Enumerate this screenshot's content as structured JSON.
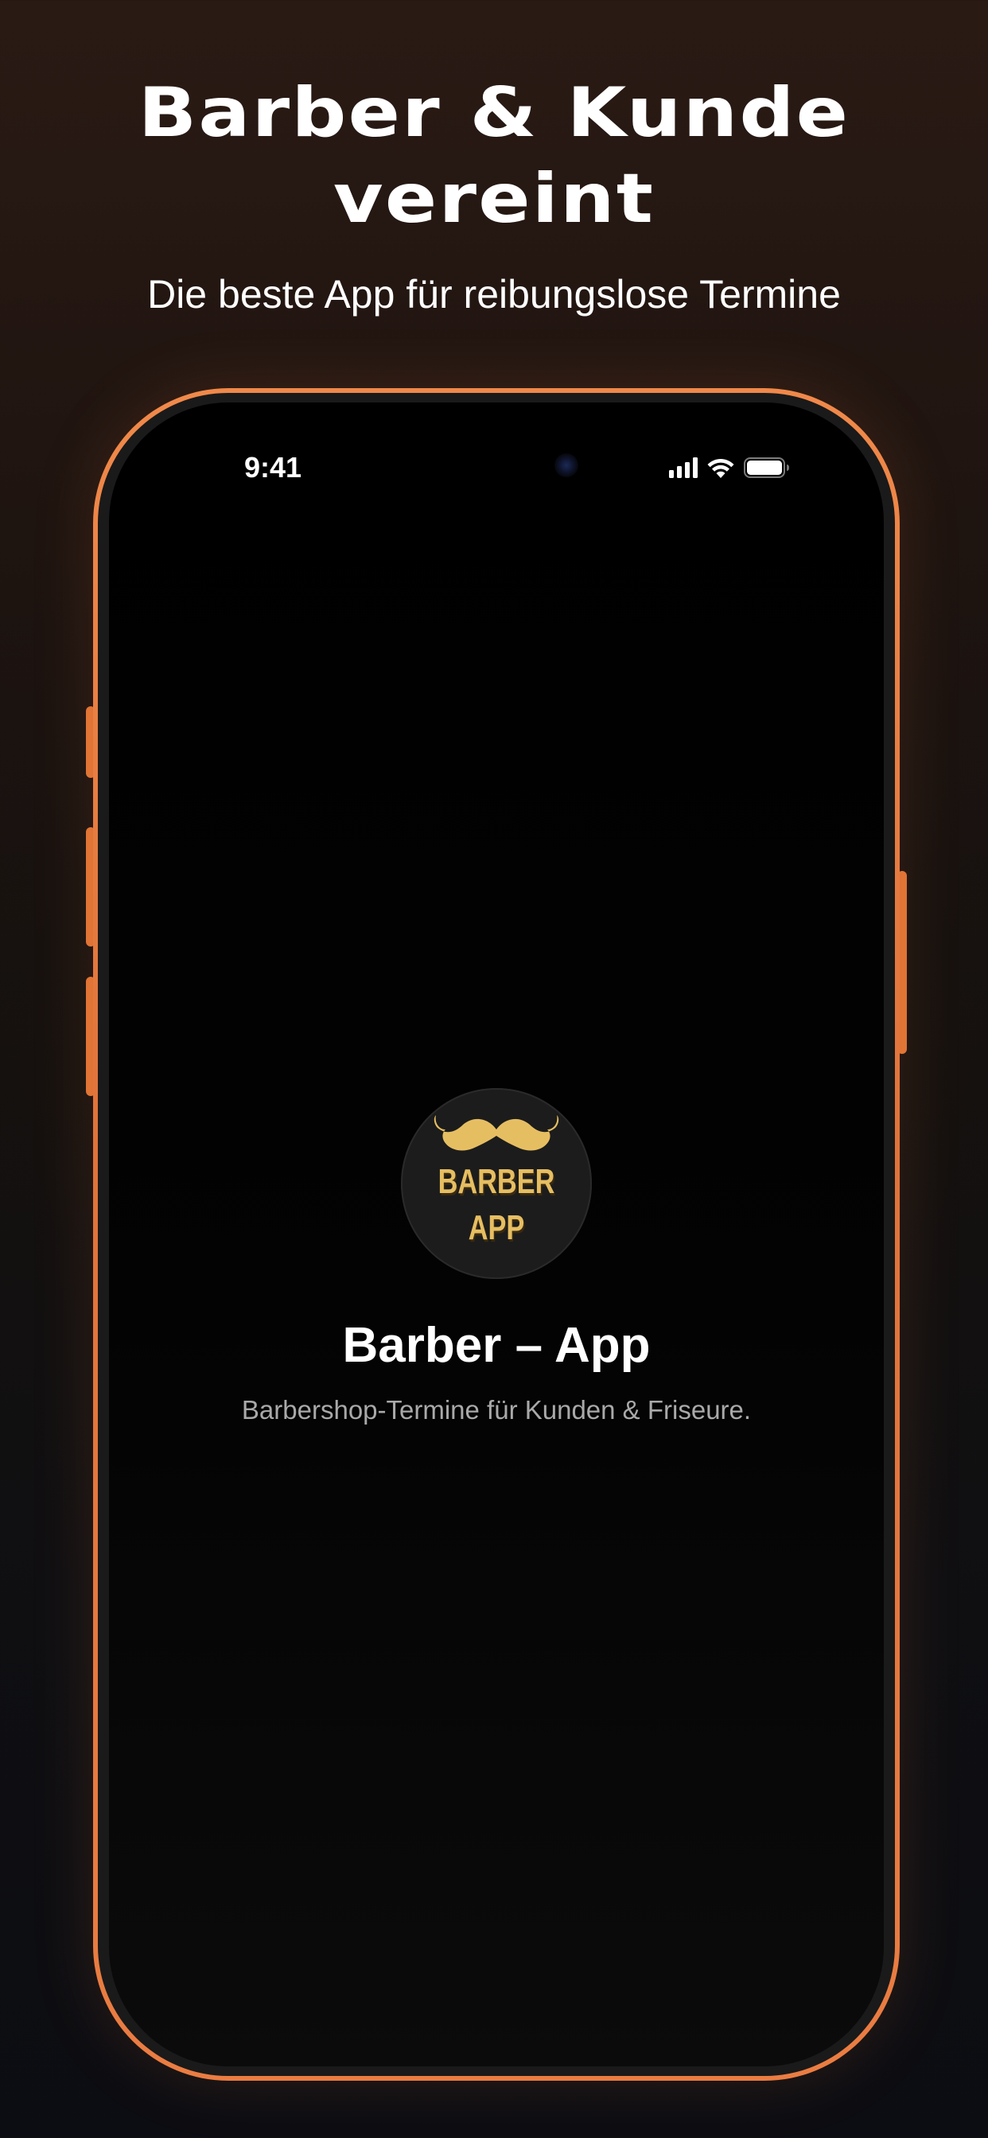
{
  "headline": {
    "line1": "Barber & Kunde",
    "line2": "vereint"
  },
  "subheadline": "Die beste App für reibungslose Termine",
  "phone": {
    "status_bar": {
      "time": "9:41",
      "icons": [
        "cellular-signal-icon",
        "wifi-icon",
        "battery-icon"
      ]
    },
    "app": {
      "icon_text_line1": "BARBER",
      "icon_text_line2": "APP",
      "icon_graphic": "moustache-icon",
      "name": "Barber – App",
      "tagline": "Barbershop-Termine für Kunden & Friseure."
    }
  },
  "colors": {
    "frame_orange": "#e8783c",
    "logo_gold": "#e6be62",
    "background_top": "#2a1a14",
    "background_bottom": "#0c0d12"
  }
}
